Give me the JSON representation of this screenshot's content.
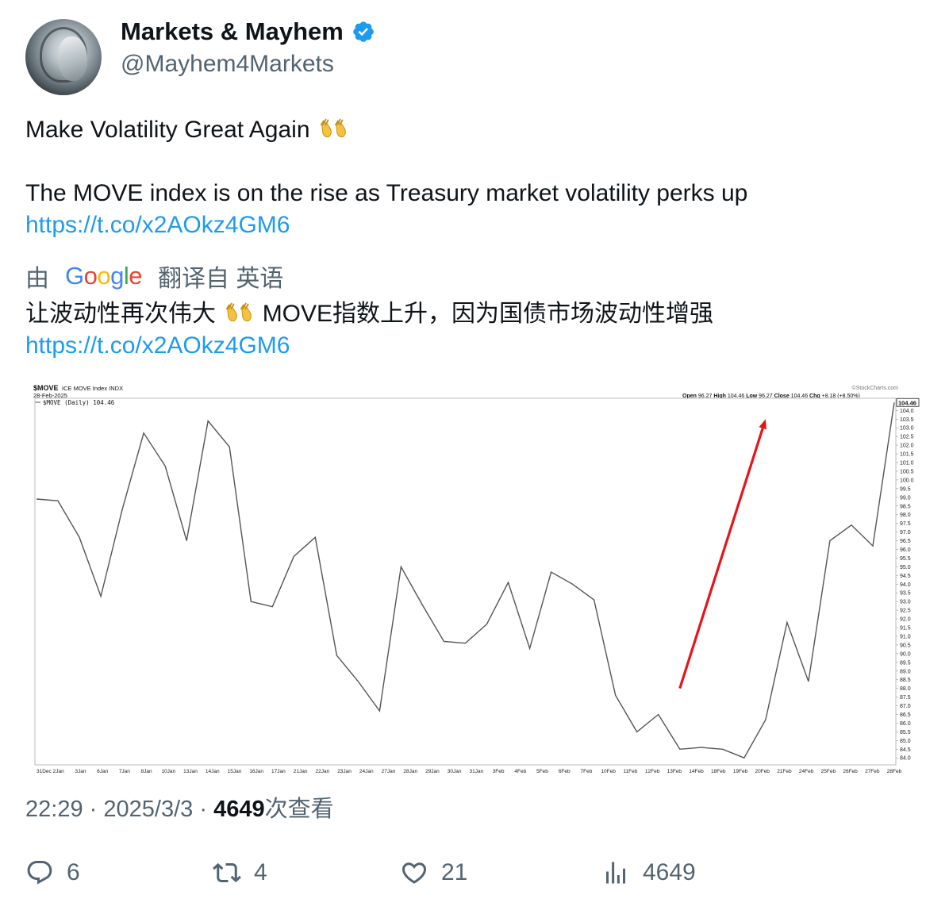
{
  "author": {
    "display_name": "Markets & Mayhem",
    "handle": "@Mayhem4Markets",
    "verified": true
  },
  "tweet": {
    "line1": "Make Volatility Great Again",
    "line2": "The MOVE index is on the rise as Treasury market volatility perks up",
    "link": "https://t.co/x2AOkz4GM6"
  },
  "translation": {
    "prefix": "由",
    "provider": "Google",
    "suffix": "翻译自 英语",
    "text_before_emoji": "让波动性再次伟大",
    "text_after_emoji": "MOVE指数上升，因为国债市场波动性增强",
    "link": "https://t.co/x2AOkz4GM6"
  },
  "meta": {
    "time": "22:29",
    "sep": "·",
    "date": "2025/3/3",
    "views": "4649",
    "views_label": "次查看"
  },
  "actions": {
    "replies": "6",
    "retweets": "4",
    "likes": "21",
    "views": "4649"
  },
  "colors": {
    "link": "#1d9bf0",
    "verified": "#1d9bf0",
    "arrow": "#e8141a",
    "muted": "#536471"
  },
  "chart_data": {
    "type": "line",
    "symbol": "$MOVE",
    "title": "ICE MOVE Index INDX",
    "date": "28-Feb-2025",
    "series_label": "$MOVE (Daily) 104.46",
    "source": "©StockCharts.com",
    "ohlc": {
      "open_label": "Open",
      "open": "96.27",
      "high_label": "High",
      "high": "104.46",
      "low_label": "Low",
      "low": "96.27",
      "close_label": "Close",
      "close": "104.46",
      "chg_label": "Chg",
      "chg": "+8.18 (+8.50%)"
    },
    "last_value_label": "104.46",
    "x": [
      "31Dec",
      "2Jan",
      "3Jan",
      "6Jan",
      "7Jan",
      "8Jan",
      "10Jan",
      "13Jan",
      "14Jan",
      "15Jan",
      "16Jan",
      "17Jan",
      "21Jan",
      "22Jan",
      "23Jan",
      "24Jan",
      "27Jan",
      "28Jan",
      "29Jan",
      "30Jan",
      "31Jan",
      "3Feb",
      "4Feb",
      "5Feb",
      "6Feb",
      "7Feb",
      "10Feb",
      "11Feb",
      "12Feb",
      "13Feb",
      "14Feb",
      "18Feb",
      "19Feb",
      "20Feb",
      "21Feb",
      "24Feb",
      "25Feb",
      "26Feb",
      "27Feb",
      "28Feb"
    ],
    "values": [
      98.9,
      98.8,
      96.7,
      93.3,
      98.3,
      102.7,
      100.8,
      96.5,
      103.4,
      101.9,
      93.0,
      92.7,
      95.6,
      96.7,
      89.9,
      88.4,
      86.7,
      95.0,
      92.8,
      90.7,
      90.6,
      91.7,
      94.1,
      90.3,
      94.7,
      94.0,
      93.1,
      87.6,
      85.5,
      86.5,
      84.5,
      84.6,
      84.5,
      84.0,
      86.2,
      91.8,
      88.4,
      96.5,
      97.4,
      96.2,
      104.46
    ],
    "y_ticks": [
      "104.0",
      "103.5",
      "103.0",
      "102.5",
      "102.0",
      "101.5",
      "101.0",
      "100.5",
      "100.0",
      "99.5",
      "99.0",
      "98.5",
      "98.0",
      "97.5",
      "97.0",
      "96.5",
      "96.0",
      "95.5",
      "95.0",
      "94.5",
      "94.0",
      "93.5",
      "93.0",
      "92.5",
      "92.0",
      "91.5",
      "91.0",
      "90.5",
      "90.0",
      "89.5",
      "89.0",
      "88.5",
      "88.0",
      "87.5",
      "87.0",
      "86.5",
      "86.0",
      "85.5",
      "85.0",
      "84.5",
      "84.0"
    ],
    "ylim": [
      83.6,
      104.7
    ],
    "arrow": {
      "from_index": 30,
      "from_value": 88.0,
      "to_index": 34,
      "to_value": 103.5
    }
  }
}
